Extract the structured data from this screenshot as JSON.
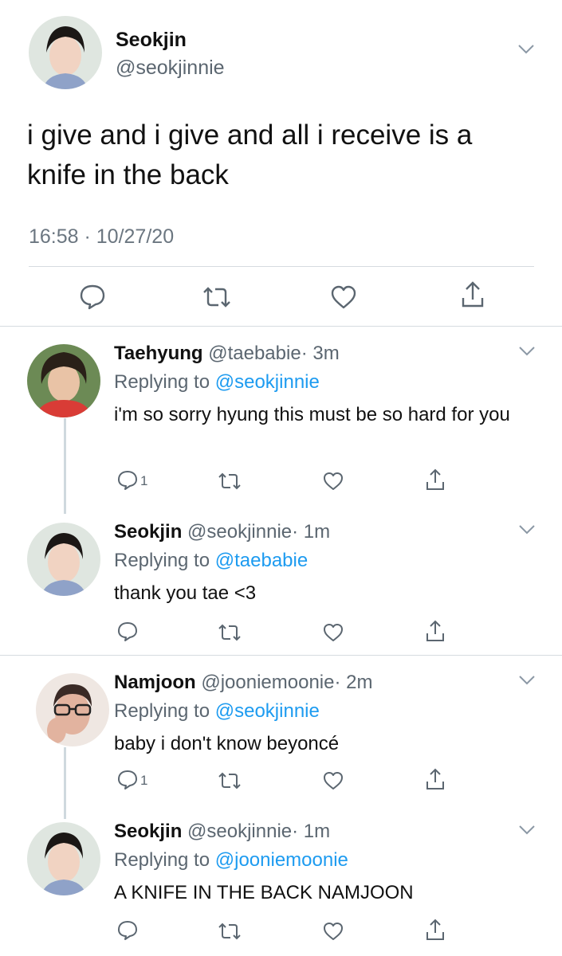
{
  "main_tweet": {
    "name": "Seokjin",
    "handle": "@seokjinnie",
    "text": "i give and i give and all i receive is a knife in the back",
    "timestamp": "16:58 · 10/27/20"
  },
  "replies": [
    {
      "name": "Taehyung",
      "handle": "@taebabie",
      "time": "· 3m",
      "replying_label": "Replying to",
      "replying_to": "@seokjinnie",
      "text": "i'm so sorry hyung this must be so hard for you",
      "reply_count": "1"
    },
    {
      "name": "Seokjin",
      "handle": "@seokjinnie",
      "time": "· 1m",
      "replying_label": "Replying to",
      "replying_to": "@taebabie",
      "text": "thank you tae <3"
    },
    {
      "name": "Namjoon",
      "handle": "@jooniemoonie",
      "time": "· 2m",
      "replying_label": "Replying to",
      "replying_to": "@seokjinnie",
      "text": "baby i don't know beyoncé",
      "reply_count": "1"
    },
    {
      "name": "Seokjin",
      "handle": "@seokjinnie",
      "time": "· 1m",
      "replying_label": "Replying to",
      "replying_to": "@jooniemoonie",
      "text": "A KNIFE IN THE BACK NAMJOON"
    }
  ],
  "icons": {
    "reply": "speech-bubble-icon",
    "retweet": "retweet-arrows-icon",
    "like": "heart-icon",
    "share": "share-upload-icon",
    "more": "chevron-down-icon"
  },
  "colors": {
    "link": "#1d9bf0",
    "secondary_text": "#5b6670",
    "divider": "#d6dbe0"
  }
}
